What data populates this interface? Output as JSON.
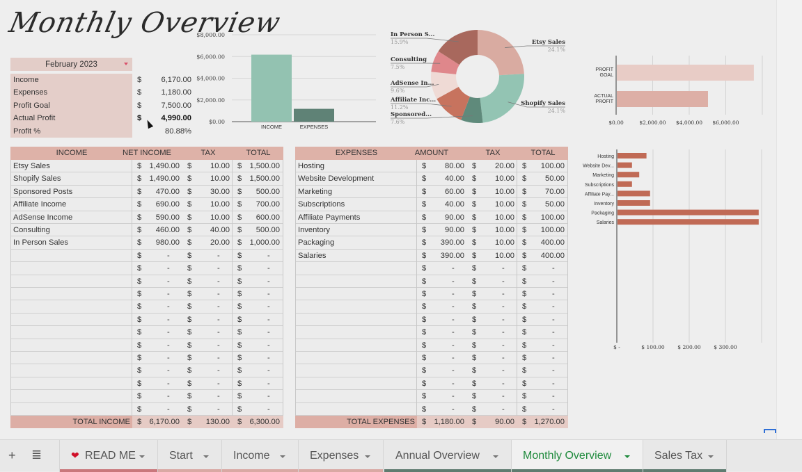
{
  "title": "Monthly Overview",
  "month_selector": {
    "value": "February 2023"
  },
  "summary": [
    {
      "label": "Income",
      "currency": "$",
      "value": "6,170.00"
    },
    {
      "label": "Expenses",
      "currency": "$",
      "value": "1,180.00"
    },
    {
      "label": "Profit Goal",
      "currency": "$",
      "value": "7,500.00"
    },
    {
      "label": "Actual Profit",
      "currency": "$",
      "value": "4,990.00"
    },
    {
      "label": "Profit %",
      "currency": "",
      "value": "80.88%"
    }
  ],
  "colors": {
    "income_bar": "#93c2b1",
    "expenses_bar": "#5f8276",
    "header_pink": "#deb2a8",
    "profit_goal_bar": "#e8ccc6",
    "actual_profit_bar": "#ddafa6",
    "expense_bar": "#c06a55",
    "active_tab": "#1e8a3c"
  },
  "chart_data": [
    {
      "type": "bar",
      "title": "",
      "categories": [
        "INCOME",
        "EXPENSES"
      ],
      "values": [
        6170,
        1180
      ],
      "yticks": [
        "$0.00",
        "$2,000.00",
        "$4,000.00",
        "$6,000.00",
        "$8,000.00"
      ],
      "ylim": [
        0,
        8000
      ],
      "grid": true
    },
    {
      "type": "pie",
      "donut": true,
      "slices": [
        {
          "label": "Etsy Sales",
          "pct": "24.1%",
          "value": 24.1,
          "color": "#d9aba1"
        },
        {
          "label": "Shopify Sales",
          "pct": "24.1%",
          "value": 24.1,
          "color": "#93c4b3"
        },
        {
          "label": "Sponsored...",
          "pct": "7.6%",
          "value": 7.6,
          "color": "#5f8a7b"
        },
        {
          "label": "Affiliate Inc...",
          "pct": "11.2%",
          "value": 11.2,
          "color": "#c7735e"
        },
        {
          "label": "AdSense In...",
          "pct": "9.6%",
          "value": 9.6,
          "color": "#efdad5"
        },
        {
          "label": "Consulting",
          "pct": "7.5%",
          "value": 7.5,
          "color": "#df878b"
        },
        {
          "label": "In Person S...",
          "pct": "15.9%",
          "value": 15.9,
          "color": "#a8685d"
        }
      ]
    },
    {
      "type": "bar",
      "orientation": "horizontal",
      "categories": [
        "PROFIT GOAL",
        "ACTUAL PROFIT"
      ],
      "values": [
        7500,
        4990
      ],
      "xticks": [
        "$0.00",
        "$2,000.00",
        "$4,000.00",
        "$6,000.00"
      ],
      "xlim": [
        0,
        8000
      ],
      "grid": true
    },
    {
      "type": "bar",
      "orientation": "horizontal",
      "categories": [
        "Hosting",
        "Website Dev...",
        "Marketing",
        "Subscriptions",
        "Affiliate Pay...",
        "Inventory",
        "Packaging",
        "Salaries"
      ],
      "values": [
        80,
        40,
        60,
        40,
        90,
        90,
        390,
        390
      ],
      "xticks": [
        "$ -",
        "$ 100.00",
        "$ 200.00",
        "$ 300.00"
      ],
      "xlim": [
        0,
        400
      ],
      "grid": true
    }
  ],
  "income_table": {
    "headers": [
      "INCOME",
      "NET INCOME",
      "TAX",
      "TOTAL"
    ],
    "rows": [
      [
        "Etsy Sales",
        "1,490.00",
        "10.00",
        "1,500.00"
      ],
      [
        "Shopify Sales",
        "1,490.00",
        "10.00",
        "1,500.00"
      ],
      [
        "Sponsored Posts",
        "470.00",
        "30.00",
        "500.00"
      ],
      [
        "Affiliate Income",
        "690.00",
        "10.00",
        "700.00"
      ],
      [
        "AdSense Income",
        "590.00",
        "10.00",
        "600.00"
      ],
      [
        "Consulting",
        "460.00",
        "40.00",
        "500.00"
      ],
      [
        "In Person Sales",
        "980.00",
        "20.00",
        "1,000.00"
      ],
      [
        "",
        "-",
        "-",
        "-"
      ],
      [
        "",
        "-",
        "-",
        "-"
      ],
      [
        "",
        "-",
        "-",
        "-"
      ],
      [
        "",
        "-",
        "-",
        "-"
      ],
      [
        "",
        "-",
        "-",
        "-"
      ],
      [
        "",
        "-",
        "-",
        "-"
      ],
      [
        "",
        "-",
        "-",
        "-"
      ],
      [
        "",
        "-",
        "-",
        "-"
      ],
      [
        "",
        "-",
        "-",
        "-"
      ],
      [
        "",
        "-",
        "-",
        "-"
      ],
      [
        "",
        "-",
        "-",
        "-"
      ],
      [
        "",
        "-",
        "-",
        "-"
      ],
      [
        "",
        "-",
        "-",
        "-"
      ]
    ],
    "total": [
      "TOTAL INCOME",
      "6,170.00",
      "130.00",
      "6,300.00"
    ]
  },
  "expenses_table": {
    "headers": [
      "EXPENSES",
      "AMOUNT",
      "TAX",
      "TOTAL"
    ],
    "rows": [
      [
        "Hosting",
        "80.00",
        "20.00",
        "100.00"
      ],
      [
        "Website Development",
        "40.00",
        "10.00",
        "50.00"
      ],
      [
        "Marketing",
        "60.00",
        "10.00",
        "70.00"
      ],
      [
        "Subscriptions",
        "40.00",
        "10.00",
        "50.00"
      ],
      [
        "Affiliate Payments",
        "90.00",
        "10.00",
        "100.00"
      ],
      [
        "Inventory",
        "90.00",
        "10.00",
        "100.00"
      ],
      [
        "Packaging",
        "390.00",
        "10.00",
        "400.00"
      ],
      [
        "Salaries",
        "390.00",
        "10.00",
        "400.00"
      ],
      [
        "",
        "-",
        "-",
        "-"
      ],
      [
        "",
        "-",
        "-",
        "-"
      ],
      [
        "",
        "-",
        "-",
        "-"
      ],
      [
        "",
        "-",
        "-",
        "-"
      ],
      [
        "",
        "-",
        "-",
        "-"
      ],
      [
        "",
        "-",
        "-",
        "-"
      ],
      [
        "",
        "-",
        "-",
        "-"
      ],
      [
        "",
        "-",
        "-",
        "-"
      ],
      [
        "",
        "-",
        "-",
        "-"
      ],
      [
        "",
        "-",
        "-",
        "-"
      ],
      [
        "",
        "-",
        "-",
        "-"
      ],
      [
        "",
        "-",
        "-",
        "-"
      ]
    ],
    "total": [
      "TOTAL EXPENSES",
      "1,180.00",
      "90.00",
      "1,270.00"
    ]
  },
  "currency_symbol": "$",
  "tabbar": {
    "add_icon": "+",
    "menu_icon": "≣",
    "tabs": [
      {
        "label": "READ ME",
        "icon": "❤️",
        "underline": "#c9777c",
        "active": false
      },
      {
        "label": "Start",
        "underline": "#d9a8a3",
        "active": false
      },
      {
        "label": "Income",
        "underline": "#d9a8a3",
        "active": false
      },
      {
        "label": "Expenses",
        "underline": "#d9a8a3",
        "active": false
      },
      {
        "label": "Annual Overview",
        "underline": "#5f7c70",
        "active": false
      },
      {
        "label": "Monthly Overview",
        "underline": "#5f7c70",
        "active": true
      },
      {
        "label": "Sales Tax",
        "underline": "#5f7c70",
        "active": false
      }
    ]
  }
}
